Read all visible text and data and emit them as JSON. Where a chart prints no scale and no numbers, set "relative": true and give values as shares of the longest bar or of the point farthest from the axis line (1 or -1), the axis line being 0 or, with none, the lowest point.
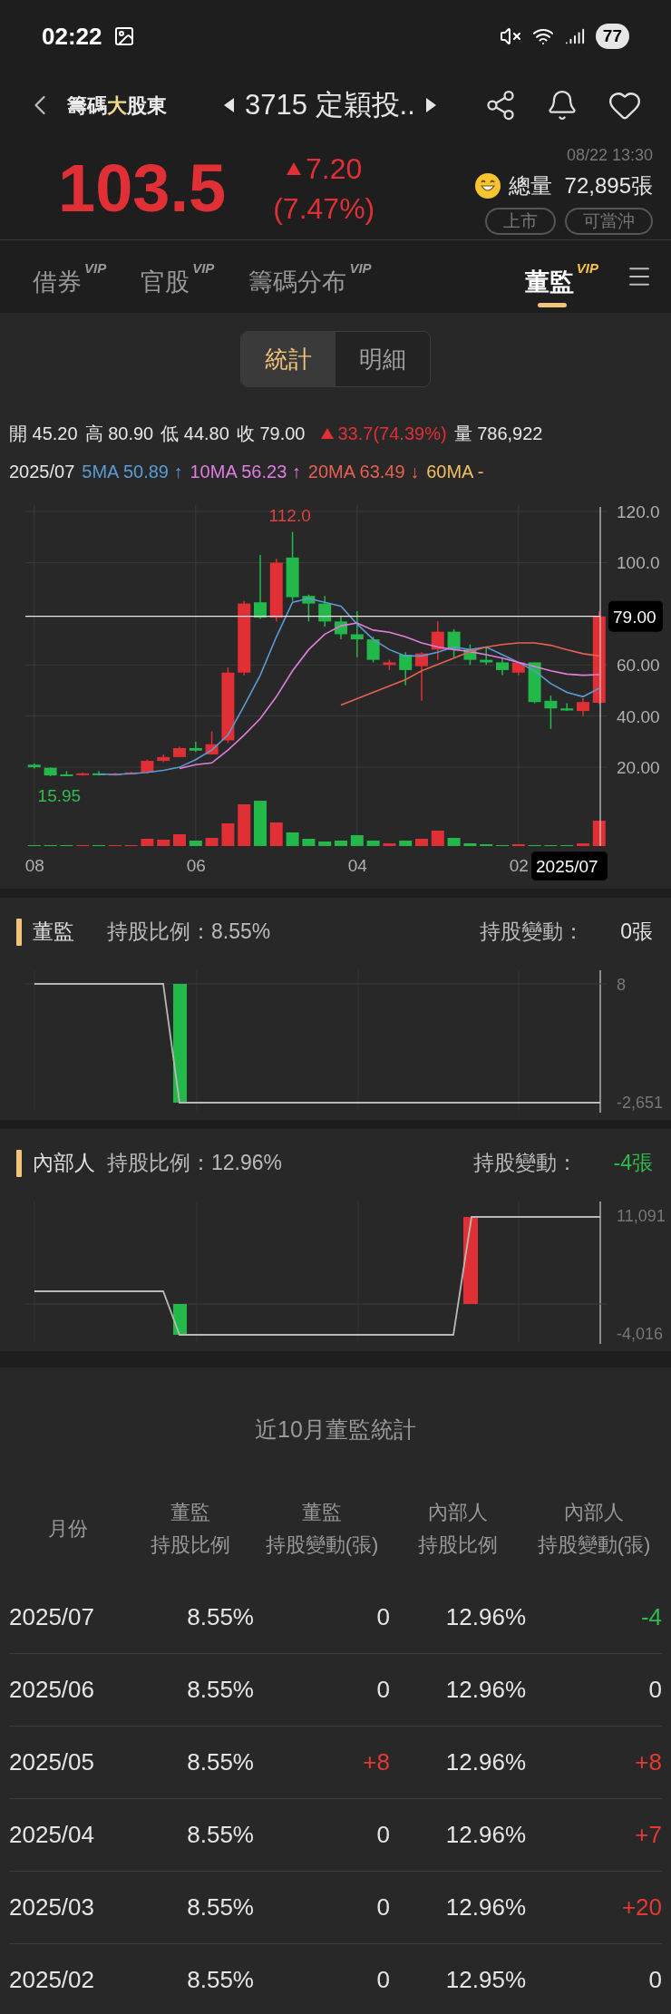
{
  "status_bar": {
    "time": "02:22",
    "battery": "77"
  },
  "header": {
    "brand": [
      {
        "text": "籌碼",
        "accent": false
      },
      {
        "text": "大",
        "accent": true
      },
      {
        "text": "股東",
        "accent": false
      }
    ],
    "stock": "3715 定穎投.."
  },
  "quote": {
    "price": "103.5",
    "change": "7.20",
    "change_percent": "(7.47%)",
    "time": "08/22 13:30",
    "volume_label": "總量",
    "volume": "72,895張",
    "tags": [
      "上市",
      "可當沖"
    ]
  },
  "tabs": [
    {
      "label": "借券",
      "badge": "VIP",
      "selected": false
    },
    {
      "label": "官股",
      "badge": "VIP",
      "selected": false
    },
    {
      "label": "籌碼分布",
      "badge": "VIP",
      "selected": false
    },
    {
      "label": "董監",
      "badge": "VIP",
      "selected": true
    }
  ],
  "segments": [
    {
      "label": "統計",
      "selected": true
    },
    {
      "label": "明細",
      "selected": false
    }
  ],
  "ohlc": [
    {
      "label": "開",
      "value": "45.20"
    },
    {
      "label": "高",
      "value": "80.90"
    },
    {
      "label": "低",
      "value": "44.80"
    },
    {
      "label": "收",
      "value": "79.00"
    }
  ],
  "ohlc_change": "33.7(74.39%)",
  "ohlc_volume": {
    "label": "量",
    "value": "786,922"
  },
  "ma_period": "2025/07",
  "ma_legend": [
    {
      "value": "50.89 ↑"
    },
    {
      "value": "56.23 ↑"
    },
    {
      "value": "63.49 ↓"
    }
  ],
  "ma_legend_extra": {
    "text": "60MA -",
    "color": "#f0c060"
  },
  "price_chart": {
    "high_label": "112.0",
    "low_label": "15.95",
    "current_label": "79.00",
    "chart_data": {
      "type": "candlestick",
      "grid": true,
      "ylim": [
        -10.8,
        122.5
      ],
      "yticks": [
        {
          "value": 120,
          "label": "120.0"
        },
        {
          "value": 100,
          "label": "100.0"
        },
        {
          "value": 60,
          "label": "60.00"
        },
        {
          "value": 40,
          "label": "40.00"
        },
        {
          "value": 20,
          "label": "20.00"
        }
      ],
      "ohlc": [
        [
          21,
          21.5,
          19.5,
          20
        ],
        [
          19.8,
          20,
          16.5,
          16.8
        ],
        [
          17.2,
          18.5,
          16.5,
          17
        ],
        [
          17,
          17.8,
          16.8,
          17.6
        ],
        [
          17.6,
          18.5,
          16.8,
          17
        ],
        [
          17,
          17.8,
          16.8,
          17.5
        ],
        [
          17.5,
          18.2,
          17.2,
          18
        ],
        [
          18,
          23,
          17.5,
          22.5
        ],
        [
          22.5,
          25,
          22,
          24
        ],
        [
          24,
          28,
          24,
          27.5
        ],
        [
          27.5,
          30,
          26,
          26.5
        ],
        [
          25,
          34,
          25,
          29
        ],
        [
          30.5,
          59,
          29.5,
          57
        ],
        [
          57,
          85,
          56,
          84
        ],
        [
          84.5,
          103,
          78,
          78.5
        ],
        [
          78.5,
          101.5,
          77,
          100
        ],
        [
          102,
          112,
          85,
          86.5
        ],
        [
          87,
          87.5,
          77,
          84
        ],
        [
          84,
          87,
          75,
          77
        ],
        [
          77,
          79,
          70,
          72
        ],
        [
          72,
          81,
          63,
          70
        ],
        [
          70,
          71,
          61,
          62
        ],
        [
          60,
          62,
          58,
          61
        ],
        [
          64,
          65,
          52,
          58
        ],
        [
          59.5,
          65,
          46,
          64.5
        ],
        [
          66,
          77,
          62,
          73
        ],
        [
          73,
          74,
          63,
          66
        ],
        [
          66,
          68,
          60,
          62
        ],
        [
          62,
          67,
          60,
          61
        ],
        [
          61,
          63,
          56,
          58
        ],
        [
          57,
          61,
          56,
          61
        ],
        [
          61,
          61,
          45,
          45.5
        ],
        [
          46,
          48,
          35,
          43
        ],
        [
          43,
          45,
          42,
          42.2
        ],
        [
          42,
          47,
          40,
          45.5
        ],
        [
          45.2,
          80.9,
          44.8,
          79
        ]
      ],
      "series": [
        {
          "name": "5MA",
          "type": "line",
          "color": "#5b9bd5",
          "values": [
            null,
            null,
            null,
            null,
            17.3,
            17.2,
            17.5,
            18,
            18.8,
            20,
            23,
            26.7,
            32.6,
            44,
            56,
            71,
            84.5,
            86,
            84.5,
            83,
            76,
            70,
            66,
            63.5,
            63.5,
            65,
            67,
            66,
            67,
            64,
            61,
            57.7,
            52.7,
            49.3,
            47.6,
            50.9
          ]
        },
        {
          "name": "10MA",
          "type": "line",
          "color": "#e07ee0",
          "values": [
            null,
            null,
            null,
            null,
            null,
            null,
            null,
            null,
            null,
            19.5,
            21,
            21.7,
            26.7,
            32.6,
            39,
            47.6,
            57.7,
            66,
            72,
            75.3,
            76.4,
            73.6,
            72.8,
            71,
            68.6,
            67,
            66,
            65.2,
            64,
            62.7,
            61,
            59.4,
            57.7,
            56.4,
            56,
            56.2
          ]
        },
        {
          "name": "20MA",
          "type": "line",
          "color": "#e8604f",
          "values": [
            null,
            null,
            null,
            null,
            null,
            null,
            null,
            null,
            null,
            null,
            null,
            null,
            null,
            null,
            null,
            null,
            null,
            null,
            null,
            44.3,
            46.8,
            49.3,
            51.8,
            54.3,
            57.7,
            60.2,
            62.7,
            65.2,
            67,
            68,
            68.6,
            68.6,
            67.7,
            66,
            64.4,
            63.5
          ]
        }
      ]
    }
  },
  "volume_chart": {
    "cursor_label": "2025/07",
    "chart_data": {
      "type": "bar",
      "relative": true,
      "stacked": true,
      "categories": [
        "08",
        null,
        null,
        null,
        null,
        null,
        null,
        null,
        null,
        null,
        "06",
        null,
        null,
        null,
        null,
        null,
        null,
        null,
        null,
        null,
        "04",
        null,
        null,
        null,
        null,
        null,
        null,
        null,
        null,
        null,
        "02",
        null,
        null,
        null,
        null,
        null
      ],
      "series": [
        {
          "color": "#e02f35",
          "values": [
            null,
            null,
            null,
            0.02,
            null,
            0.02,
            0.02,
            0.16,
            0.14,
            0.26,
            null,
            0.18,
            0.5,
            0.92,
            null,
            0.52,
            null,
            null,
            null,
            null,
            null,
            null,
            0.06,
            null,
            0.16,
            0.34,
            null,
            null,
            null,
            null,
            0.04,
            null,
            null,
            null,
            0.06,
            0.56
          ]
        },
        {
          "color": "#22b84a",
          "values": [
            0.02,
            0.02,
            0.02,
            null,
            0.02,
            null,
            null,
            null,
            null,
            null,
            0.12,
            null,
            null,
            null,
            1,
            null,
            0.3,
            0.16,
            0.1,
            0.12,
            0.24,
            0.12,
            null,
            0.12,
            null,
            null,
            0.18,
            0.06,
            0.04,
            0.02,
            null,
            0.02,
            0.02,
            0.02,
            null,
            null
          ]
        }
      ]
    }
  },
  "panels": [
    {
      "title": "董監",
      "ratio": "持股比例：8.55%",
      "change_label": "持股變動：",
      "change": {
        "text": "0張",
        "color": "#e6e6e6"
      },
      "top_label": "8",
      "bottom_label": "-2,651",
      "kind": "director"
    },
    {
      "title": "內部人",
      "ratio": "持股比例：12.96%",
      "change_label": "持股變動：",
      "change": {
        "text": "-4張",
        "color": "#2ebd4e"
      },
      "top_label": "11,091",
      "bottom_label": "-4,016",
      "kind": "insider"
    }
  ],
  "table": {
    "title": "近10月董監統計",
    "columns": [
      [
        "月份"
      ],
      [
        "董監",
        "持股比例"
      ],
      [
        "董監",
        "持股變動(張)"
      ],
      [
        "內部人",
        "持股比例"
      ],
      [
        "內部人",
        "持股變動(張)"
      ]
    ],
    "rows": [
      {
        "month": "2025/07",
        "director_ratio": "8.55%",
        "director_change": {
          "text": "0",
          "color": "#e6e6e6"
        },
        "insider_ratio": "12.96%",
        "insider_change": {
          "text": "-4",
          "color": "#2ebd4e"
        }
      },
      {
        "month": "2025/06",
        "director_ratio": "8.55%",
        "director_change": {
          "text": "0",
          "color": "#e6e6e6"
        },
        "insider_ratio": "12.96%",
        "insider_change": {
          "text": "0",
          "color": "#e6e6e6"
        }
      },
      {
        "month": "2025/05",
        "director_ratio": "8.55%",
        "director_change": {
          "text": "+8",
          "color": "#e53935"
        },
        "insider_ratio": "12.96%",
        "insider_change": {
          "text": "+8",
          "color": "#e53935"
        }
      },
      {
        "month": "2025/04",
        "director_ratio": "8.55%",
        "director_change": {
          "text": "0",
          "color": "#e6e6e6"
        },
        "insider_ratio": "12.96%",
        "insider_change": {
          "text": "+7",
          "color": "#e53935"
        }
      },
      {
        "month": "2025/03",
        "director_ratio": "8.55%",
        "director_change": {
          "text": "0",
          "color": "#e6e6e6"
        },
        "insider_ratio": "12.96%",
        "insider_change": {
          "text": "+20",
          "color": "#e53935"
        }
      },
      {
        "month": "2025/02",
        "director_ratio": "8.55%",
        "director_change": {
          "text": "0",
          "color": "#e6e6e6"
        },
        "insider_ratio": "12.95%",
        "insider_change": {
          "text": "0",
          "color": "#e6e6e6"
        }
      }
    ]
  }
}
